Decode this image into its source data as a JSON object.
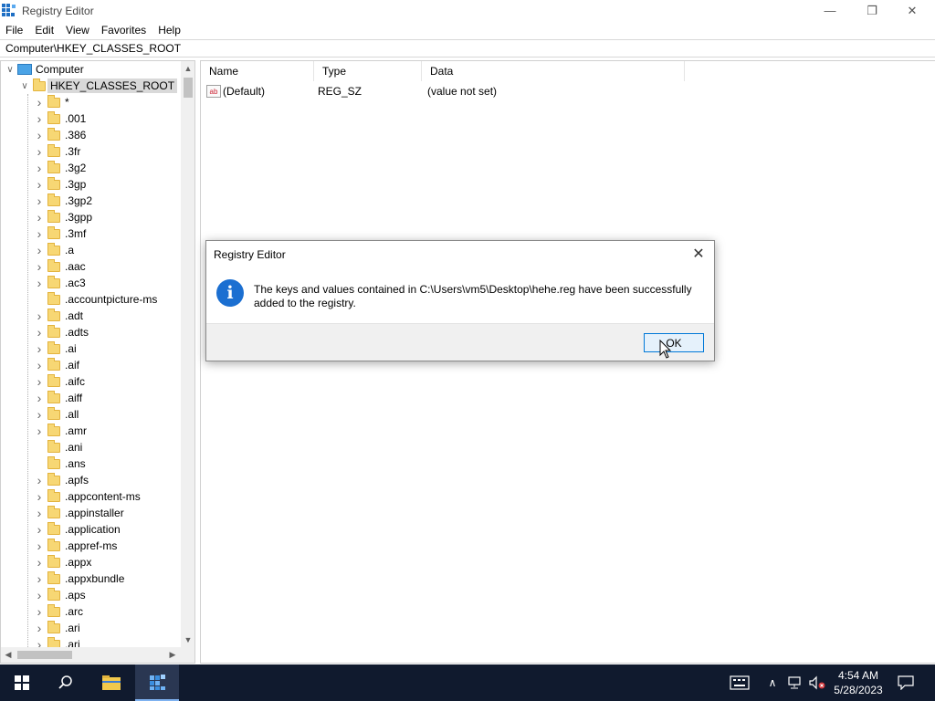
{
  "window": {
    "title": "Registry Editor",
    "minimize_glyph": "—",
    "maximize_glyph": "❐",
    "close_glyph": "✕"
  },
  "menu": [
    "File",
    "Edit",
    "View",
    "Favorites",
    "Help"
  ],
  "address": "Computer\\HKEY_CLASSES_ROOT",
  "tree": {
    "root_label": "Computer",
    "hive_label": "HKEY_CLASSES_ROOT",
    "keys": [
      "*",
      ".001",
      ".386",
      ".3fr",
      ".3g2",
      ".3gp",
      ".3gp2",
      ".3gpp",
      ".3mf",
      ".a",
      ".aac",
      ".ac3",
      ".accountpicture-ms",
      ".adt",
      ".adts",
      ".ai",
      ".aif",
      ".aifc",
      ".aiff",
      ".all",
      ".amr",
      ".ani",
      ".ans",
      ".apfs",
      ".appcontent-ms",
      ".appinstaller",
      ".application",
      ".appref-ms",
      ".appx",
      ".appxbundle",
      ".aps",
      ".arc",
      ".ari",
      ".arj"
    ],
    "has_children": [
      true,
      true,
      true,
      true,
      true,
      true,
      true,
      true,
      true,
      true,
      true,
      true,
      false,
      true,
      true,
      true,
      true,
      true,
      true,
      true,
      true,
      false,
      false,
      true,
      true,
      true,
      true,
      true,
      true,
      true,
      true,
      true,
      true,
      true
    ]
  },
  "list": {
    "columns": [
      "Name",
      "Type",
      "Data"
    ],
    "rows": [
      {
        "name": "(Default)",
        "type": "REG_SZ",
        "data": "(value not set)",
        "icon": "string-value-icon"
      }
    ]
  },
  "dialog": {
    "title": "Registry Editor",
    "message": "The keys and values contained in C:\\Users\\vm5\\Desktop\\hehe.reg have been successfully added to the registry.",
    "ok_label": "OK",
    "icon": "info-icon"
  },
  "taskbar": {
    "time": "4:54 AM",
    "date": "5/28/2023"
  },
  "colors": {
    "taskbar_bg": "#101a2e",
    "accent": "#0078d7",
    "info_icon": "#1b6fd1",
    "folder": "#f7d774"
  }
}
